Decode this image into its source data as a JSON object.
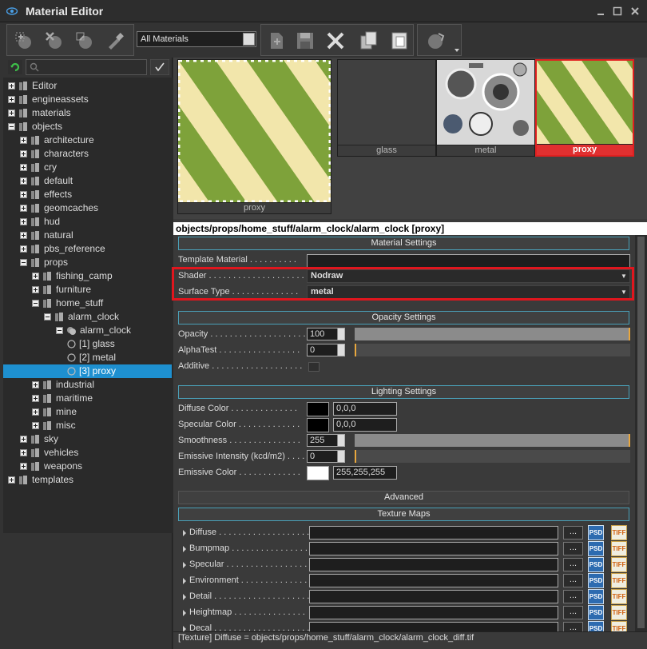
{
  "window": {
    "title": "Material Editor"
  },
  "toolbar": {
    "material_filter": "All Materials",
    "icons": [
      "add-material-icon",
      "remove-material-icon",
      "pick-material-icon",
      "eyedropper-icon",
      "new-icon",
      "save-icon",
      "delete-icon",
      "copy-icon",
      "paste-icon",
      "preview-shape-icon"
    ]
  },
  "tree": {
    "items": [
      {
        "label": "Editor",
        "depth": 0,
        "exp": "plus"
      },
      {
        "label": "engineassets",
        "depth": 0,
        "exp": "plus"
      },
      {
        "label": "materials",
        "depth": 0,
        "exp": "plus"
      },
      {
        "label": "objects",
        "depth": 0,
        "exp": "minus"
      },
      {
        "label": "architecture",
        "depth": 1,
        "exp": "plus"
      },
      {
        "label": "characters",
        "depth": 1,
        "exp": "plus"
      },
      {
        "label": "cry",
        "depth": 1,
        "exp": "plus"
      },
      {
        "label": "default",
        "depth": 1,
        "exp": "plus"
      },
      {
        "label": "effects",
        "depth": 1,
        "exp": "plus"
      },
      {
        "label": "geomcaches",
        "depth": 1,
        "exp": "plus"
      },
      {
        "label": "hud",
        "depth": 1,
        "exp": "plus"
      },
      {
        "label": "natural",
        "depth": 1,
        "exp": "plus"
      },
      {
        "label": "pbs_reference",
        "depth": 1,
        "exp": "plus"
      },
      {
        "label": "props",
        "depth": 1,
        "exp": "minus"
      },
      {
        "label": "fishing_camp",
        "depth": 2,
        "exp": "plus"
      },
      {
        "label": "furniture",
        "depth": 2,
        "exp": "plus"
      },
      {
        "label": "home_stuff",
        "depth": 2,
        "exp": "minus"
      },
      {
        "label": "alarm_clock",
        "depth": 3,
        "exp": "minus"
      },
      {
        "label": "alarm_clock",
        "depth": 4,
        "exp": "minus",
        "kind": "multi"
      },
      {
        "label": "[1] glass",
        "depth": 5,
        "exp": "none",
        "kind": "sub"
      },
      {
        "label": "[2] metal",
        "depth": 5,
        "exp": "none",
        "kind": "sub"
      },
      {
        "label": "[3] proxy",
        "depth": 5,
        "exp": "none",
        "kind": "sub",
        "selected": true
      },
      {
        "label": "industrial",
        "depth": 2,
        "exp": "plus"
      },
      {
        "label": "maritime",
        "depth": 2,
        "exp": "plus"
      },
      {
        "label": "mine",
        "depth": 2,
        "exp": "plus"
      },
      {
        "label": "misc",
        "depth": 2,
        "exp": "plus"
      },
      {
        "label": "sky",
        "depth": 1,
        "exp": "plus"
      },
      {
        "label": "vehicles",
        "depth": 1,
        "exp": "plus"
      },
      {
        "label": "weapons",
        "depth": 1,
        "exp": "plus"
      },
      {
        "label": "templates",
        "depth": 0,
        "exp": "plus"
      }
    ]
  },
  "preview": {
    "large_caption": "proxy",
    "thumbs": [
      {
        "caption": "glass",
        "selected": false
      },
      {
        "caption": "metal",
        "selected": false
      },
      {
        "caption": "proxy",
        "selected": true
      }
    ]
  },
  "path": "objects/props/home_stuff/alarm_clock/alarm_clock [proxy]",
  "material_settings": {
    "header": "Material Settings",
    "template_label": "Template Material . . . . . . . . . .",
    "template_value": "",
    "shader_label": "Shader . . . . . . . . . . . . . . . . . . . . .",
    "shader_value": "Nodraw",
    "surface_label": "Surface Type . . . . . . . . . . . . . .",
    "surface_value": "metal"
  },
  "opacity_settings": {
    "header": "Opacity Settings",
    "opacity_label": "Opacity . . . . . . . . . . . . . . . . . . . .",
    "opacity_value": "100",
    "opacity_fraction": 1.0,
    "alphatest_label": "AlphaTest . . . . . . . . . . . . . . . . .",
    "alphatest_value": "0",
    "alphatest_fraction": 0.0,
    "additive_label": "Additive . . . . . . . . . . . . . . . . . . .",
    "additive_checked": false
  },
  "lighting_settings": {
    "header": "Lighting Settings",
    "diffuse_label": "Diffuse Color . . . . . . . . . . . . . .",
    "diffuse_value": "0,0,0",
    "diffuse_color": "#000000",
    "specular_label": "Specular Color . . . . . . . . . . . . .",
    "specular_value": "0,0,0",
    "specular_color": "#000000",
    "smoothness_label": "Smoothness . . . . . . . . . . . . . . .",
    "smoothness_value": "255",
    "smoothness_fraction": 1.0,
    "emissive_int_label": "Emissive Intensity (kcd/m2) . . . .",
    "emissive_int_value": "0",
    "emissive_int_fraction": 0.0,
    "emissive_color_label": "Emissive Color . . . . . . . . . . . . .",
    "emissive_color_value": "255,255,255",
    "emissive_color": "#ffffff"
  },
  "advanced": {
    "header": "Advanced"
  },
  "texture_maps": {
    "header": "Texture Maps",
    "rows": [
      {
        "label": "Diffuse . . . . . . . . . . . . . . . . . . ."
      },
      {
        "label": "Bumpmap . . . . . . . . . . . . . . . . ."
      },
      {
        "label": "Specular . . . . . . . . . . . . . . . . ."
      },
      {
        "label": "Environment . . . . . . . . . . . . . ."
      },
      {
        "label": "Detail . . . . . . . . . . . . . . . . . . . ."
      },
      {
        "label": "Heightmap . . . . . . . . . . . . . . ."
      },
      {
        "label": "Decal . . . . . . . . . . . . . . . . . . . ."
      }
    ],
    "dots": "...",
    "psd": "PSD",
    "tiff": "TIFF"
  },
  "status": "[Texture] Diffuse = objects/props/home_stuff/alarm_clock/alarm_clock_diff.tif",
  "colors": {
    "accent": "#1e90d0",
    "highlight": "#e0161e",
    "section_border": "#4aa0b8"
  }
}
